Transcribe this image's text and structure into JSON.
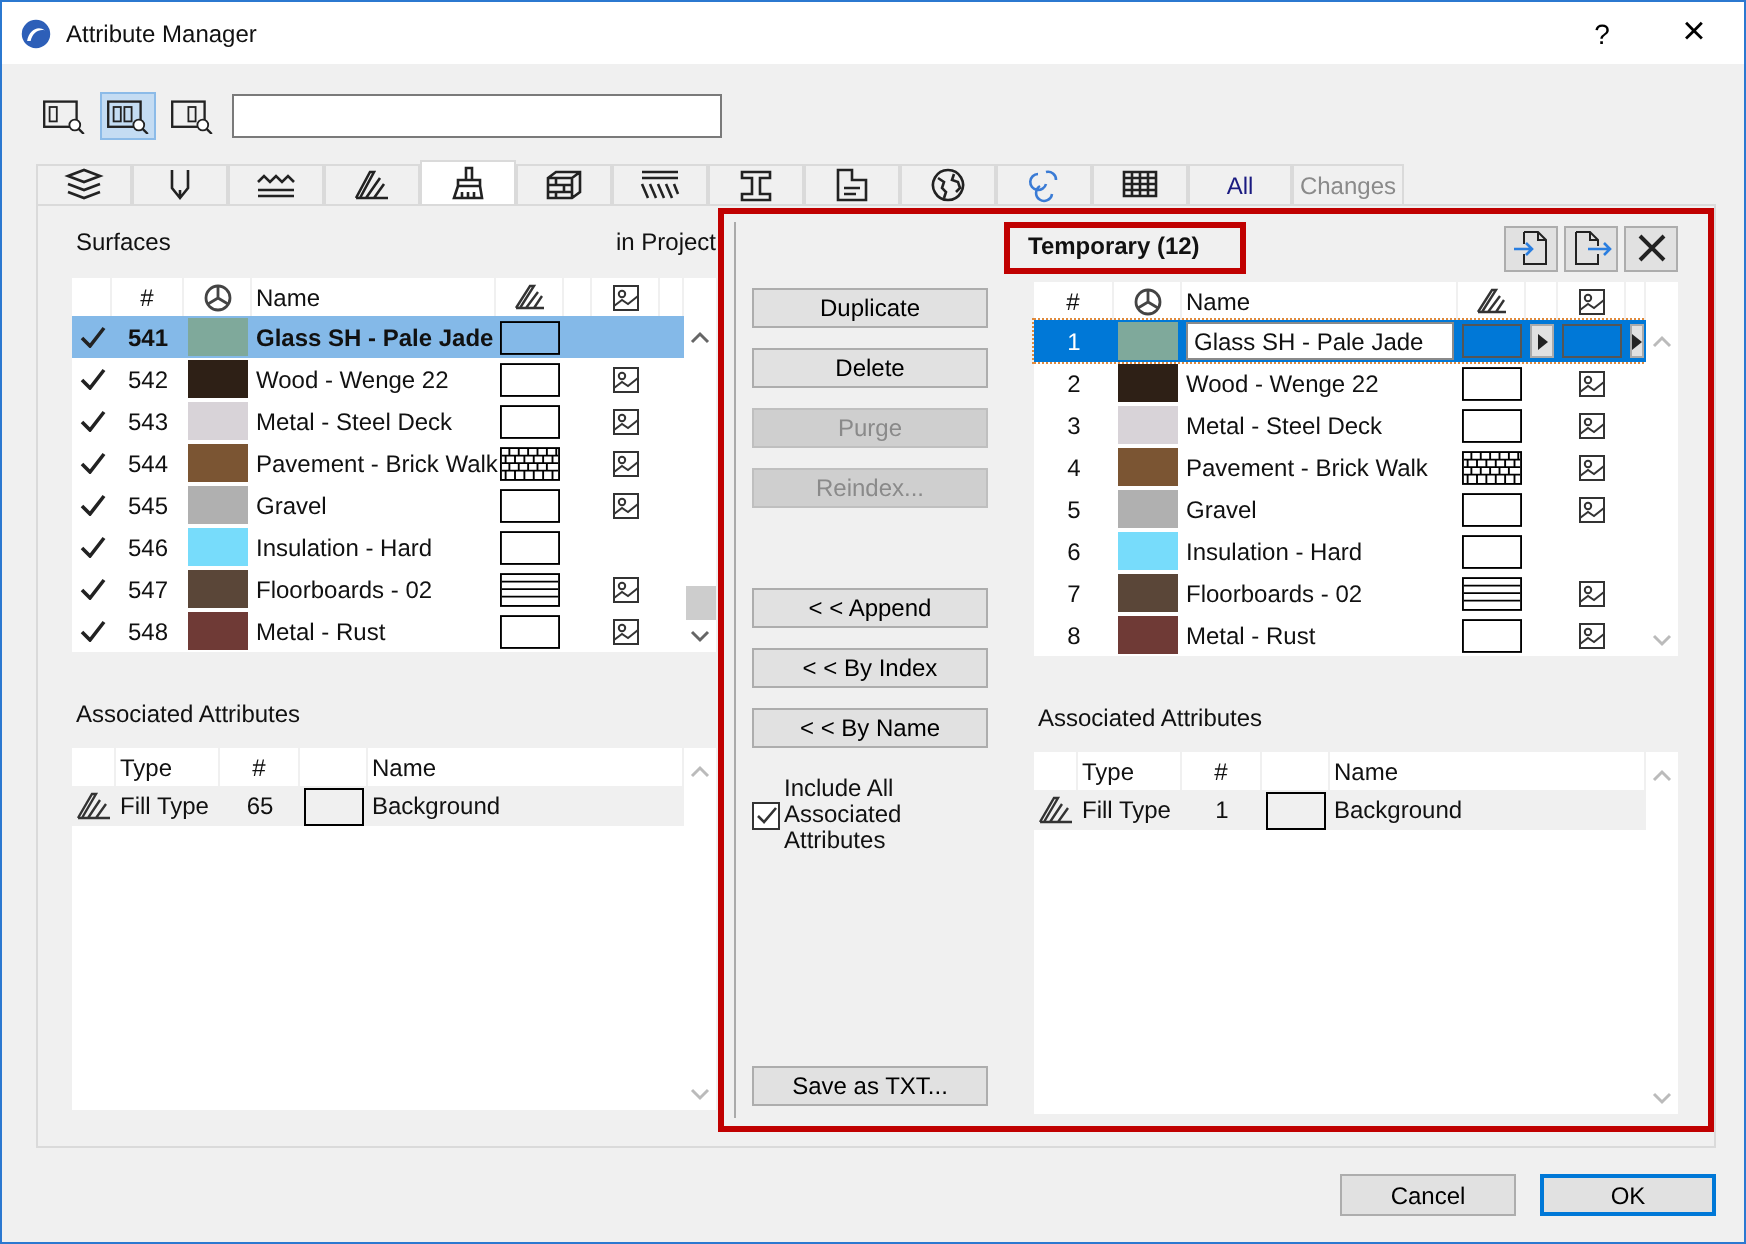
{
  "window": {
    "title": "Attribute Manager",
    "help": "?",
    "close": "×"
  },
  "view_modes": [
    {
      "kind": "left",
      "selected": false
    },
    {
      "kind": "both",
      "selected": true
    },
    {
      "kind": "right",
      "selected": false
    }
  ],
  "tabs": [
    {
      "kind": "layers",
      "selected": false
    },
    {
      "kind": "pens",
      "selected": false
    },
    {
      "kind": "lines",
      "selected": false
    },
    {
      "kind": "fills",
      "selected": false
    },
    {
      "kind": "surfaces",
      "selected": true
    },
    {
      "kind": "composites",
      "selected": false
    },
    {
      "kind": "hatch",
      "selected": false
    },
    {
      "kind": "beam",
      "selected": false
    },
    {
      "kind": "zones",
      "selected": false
    },
    {
      "kind": "globe",
      "selected": false
    },
    {
      "kind": "swirl",
      "selected": false
    },
    {
      "kind": "grid",
      "selected": false
    },
    {
      "kind": "text",
      "label": "All",
      "selected": false,
      "disabled": false
    },
    {
      "kind": "text",
      "label": "Changes",
      "selected": false,
      "disabled": true
    }
  ],
  "project": {
    "title": "Surfaces",
    "source": "in Project",
    "columns": [
      "#",
      "Name"
    ],
    "rows": [
      {
        "checked": true,
        "number": "541",
        "color": "#7fa99b",
        "name": "Glass SH - Pale Jade",
        "fill": {
          "kind": "empty"
        },
        "texture": false,
        "selected": true
      },
      {
        "checked": true,
        "number": "542",
        "color": "#2e2016",
        "name": "Wood - Wenge 22",
        "fill": {
          "kind": "empty"
        },
        "texture": true,
        "selected": false
      },
      {
        "checked": true,
        "number": "543",
        "color": "#d8d3d8",
        "name": "Metal - Steel Deck",
        "fill": {
          "kind": "empty"
        },
        "texture": true,
        "selected": false
      },
      {
        "checked": true,
        "number": "544",
        "color": "#7b5533",
        "name": "Pavement - Brick Walk",
        "fill": {
          "kind": "brick"
        },
        "texture": true,
        "selected": false
      },
      {
        "checked": true,
        "number": "545",
        "color": "#b0b0b0",
        "name": "Gravel",
        "fill": {
          "kind": "empty"
        },
        "texture": true,
        "selected": false
      },
      {
        "checked": true,
        "number": "546",
        "color": "#77dcfb",
        "name": "Insulation - Hard",
        "fill": {
          "kind": "empty"
        },
        "texture": false,
        "selected": false
      },
      {
        "checked": true,
        "number": "547",
        "color": "#5a4638",
        "name": "Floorboards - 02",
        "fill": {
          "kind": "lines"
        },
        "texture": true,
        "selected": false
      },
      {
        "checked": true,
        "number": "548",
        "color": "#6f3a36",
        "name": "Metal - Rust",
        "fill": {
          "kind": "empty"
        },
        "texture": true,
        "selected": false
      }
    ]
  },
  "edit_actions": [
    {
      "label": "Duplicate",
      "disabled": false
    },
    {
      "label": "Delete",
      "disabled": false
    },
    {
      "label": "Purge",
      "disabled": true
    },
    {
      "label": "Reindex...",
      "disabled": true
    }
  ],
  "transfer_actions": [
    {
      "label": "< < Append",
      "disabled": false
    },
    {
      "label": "< < By Index",
      "disabled": false
    },
    {
      "label": "< < By Name",
      "disabled": false
    }
  ],
  "include_associated": {
    "label": "Include All Associated Attributes",
    "checked": true
  },
  "save_button": "Save as TXT...",
  "temporary": {
    "title": "Temporary (12)",
    "columns": [
      "#",
      "Name"
    ],
    "rows": [
      {
        "number": "1",
        "color": "#7fa99b",
        "name": "Glass SH - Pale Jade",
        "selected": true
      },
      {
        "number": "2",
        "color": "#2e2016",
        "name": "Wood - Wenge 22",
        "fill": {
          "kind": "empty"
        },
        "texture": true,
        "selected": false
      },
      {
        "number": "3",
        "color": "#d8d3d8",
        "name": "Metal - Steel Deck",
        "fill": {
          "kind": "empty"
        },
        "texture": true,
        "selected": false
      },
      {
        "number": "4",
        "color": "#7b5533",
        "name": "Pavement - Brick Walk",
        "fill": {
          "kind": "brick"
        },
        "texture": true,
        "selected": false
      },
      {
        "number": "5",
        "color": "#b0b0b0",
        "name": "Gravel",
        "fill": {
          "kind": "empty"
        },
        "texture": true,
        "selected": false
      },
      {
        "number": "6",
        "color": "#77dcfb",
        "name": "Insulation - Hard",
        "fill": {
          "kind": "empty"
        },
        "texture": false,
        "selected": false
      },
      {
        "number": "7",
        "color": "#5a4638",
        "name": "Floorboards - 02",
        "fill": {
          "kind": "lines"
        },
        "texture": true,
        "selected": false
      },
      {
        "number": "8",
        "color": "#6f3a36",
        "name": "Metal - Rust",
        "fill": {
          "kind": "empty"
        },
        "texture": true,
        "selected": false
      }
    ]
  },
  "associated_left": {
    "title": "Associated Attributes",
    "columns": [
      "Type",
      "#",
      "Name"
    ],
    "rows": [
      {
        "type": "Fill Type",
        "number": "65",
        "name": "Background"
      }
    ]
  },
  "associated_right": {
    "title": "Associated Attributes",
    "columns": [
      "Type",
      "#",
      "Name"
    ],
    "rows": [
      {
        "type": "Fill Type",
        "number": "1",
        "name": "Background"
      }
    ]
  },
  "footer": {
    "buttons": [
      {
        "label": "Cancel",
        "default": false
      },
      {
        "label": "OK",
        "default": true
      }
    ]
  }
}
